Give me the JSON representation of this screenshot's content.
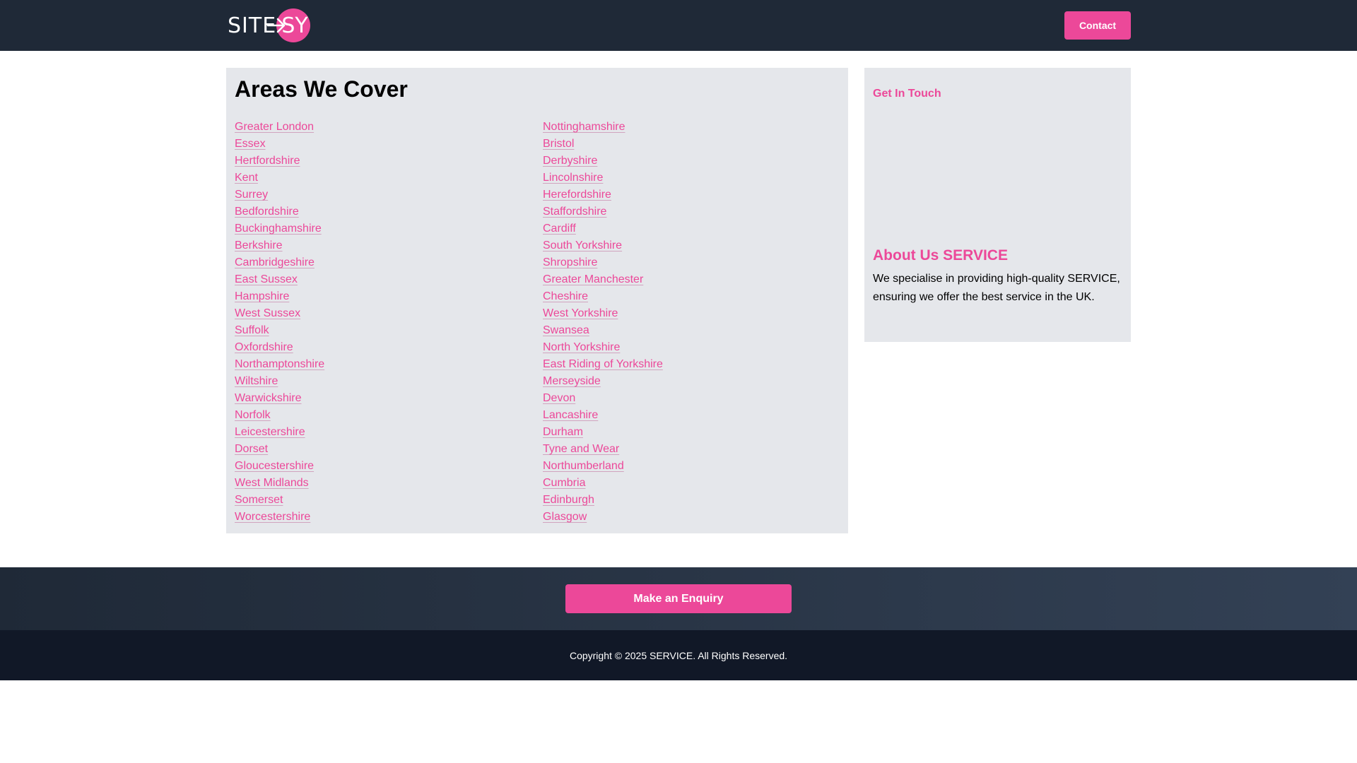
{
  "header": {
    "logo_left": "SITE",
    "logo_right": "SY",
    "contact_label": "Contact"
  },
  "areas": {
    "title": "Areas We Cover",
    "column_left": [
      "Greater London",
      "Essex",
      "Hertfordshire",
      "Kent",
      "Surrey",
      "Bedfordshire",
      "Buckinghamshire",
      "Berkshire",
      "Cambridgeshire",
      "East Sussex",
      "Hampshire",
      "West Sussex",
      "Suffolk",
      "Oxfordshire",
      "Northamptonshire",
      "Wiltshire",
      "Warwickshire",
      "Norfolk",
      "Leicestershire",
      "Dorset",
      "Gloucestershire",
      "West Midlands",
      "Somerset",
      "Worcestershire"
    ],
    "column_right": [
      "Nottinghamshire",
      "Bristol",
      "Derbyshire",
      "Lincolnshire",
      "Herefordshire",
      "Staffordshire",
      "Cardiff",
      "South Yorkshire",
      "Shropshire",
      "Greater Manchester",
      "Cheshire",
      "West Yorkshire",
      "Swansea",
      "North Yorkshire",
      "East Riding of Yorkshire",
      "Merseyside",
      "Devon",
      "Lancashire",
      "Durham",
      "Tyne and Wear",
      "Northumberland",
      "Cumbria",
      "Edinburgh",
      "Glasgow"
    ]
  },
  "sidebar": {
    "get_in_touch": "Get In Touch",
    "about_title": "About Us SERVICE",
    "about_text": "We specialise in providing high-quality SERVICE, ensuring we offer the best service in the UK."
  },
  "cta": {
    "enquiry_label": "Make an Enquiry"
  },
  "footer": {
    "copyright": "Copyright © 2025 SERVICE. All Rights Reserved."
  },
  "colors": {
    "brand_pink": "#ec4899",
    "header_bg": "#1f2937",
    "panel_bg": "#e5e7eb",
    "footer_bg": "#111827"
  },
  "icons": {
    "logo_arrow": "arrow-right-icon"
  }
}
